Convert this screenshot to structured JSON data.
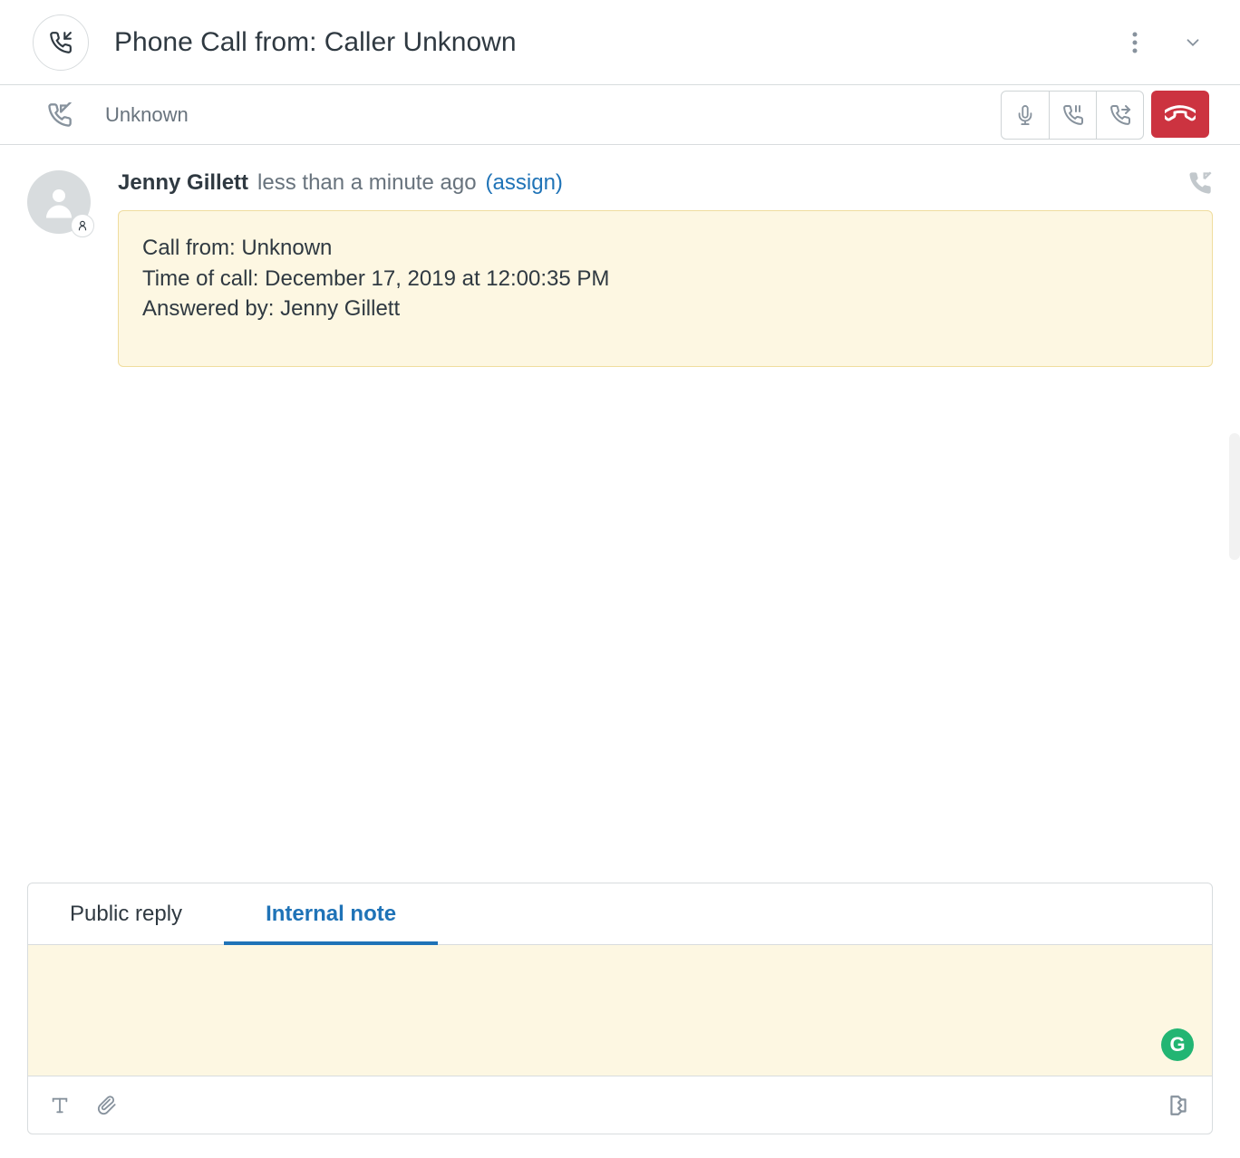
{
  "header": {
    "title": "Phone Call from: Caller Unknown"
  },
  "callbar": {
    "caller": "Unknown"
  },
  "message": {
    "author": "Jenny Gillett",
    "time": "less than a minute ago",
    "assign_label": "(assign)",
    "note_line1": "Call from: Unknown",
    "note_line2": "Time of call: December 17, 2019 at 12:00:35 PM",
    "note_line3": "Answered by: Jenny Gillett"
  },
  "composer": {
    "tab_public": "Public reply",
    "tab_internal": "Internal note",
    "text": "",
    "grammarly_badge": "G"
  }
}
